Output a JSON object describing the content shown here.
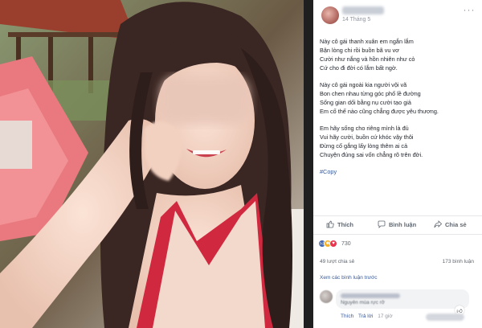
{
  "post": {
    "time": "14 Tháng 5",
    "more_icon": "more-dots-icon",
    "body_lines": [
      "Này cô gái thanh xuân em ngắn lắm",
      "Bận lòng chi rồi buồn bã vu vơ",
      "Cười như nắng và hồn nhiên như cỏ",
      "Cứ cho đi đời có lắm bất ngờ.",
      "",
      "Này cô gái ngoài kia người vội vã",
      "Bon chen nhau từng góc phố lề đường",
      "Sống gian dối bằng nụ cười tạo giả",
      "Em cố thế nào cũng chẳng được yêu thương.",
      "",
      "Em hãy sống cho riêng mình là đủ",
      "Vui hãy cười, buồn cứ khóc vậy thôi",
      "Đừng cố gắng lấy lòng thêm ai cả",
      "Chuyện đúng sai vốn chẳng rõ trên đời."
    ],
    "hashtag": "#Copy"
  },
  "actions": {
    "like": "Thích",
    "comment": "Bình luận",
    "share": "Chia sẻ"
  },
  "reactions": {
    "icons": [
      "like-reaction-icon",
      "haha-reaction-icon",
      "love-reaction-icon"
    ],
    "count": "730"
  },
  "stats": {
    "shares": "49 lượt chia sẻ",
    "comments": "173 bình luận"
  },
  "view_previous": "Xem các bình luận trước",
  "comment": {
    "text": "Nguyên mùa rực rỡ",
    "like": "Thích",
    "reply": "Trả lời",
    "time": "17 giờ"
  },
  "colors": {
    "link": "#385898",
    "like_reaction": "#4267b2",
    "love_reaction": "#e8344e",
    "haha_reaction": "#f7b125",
    "swimsuit": "#d0283e"
  }
}
